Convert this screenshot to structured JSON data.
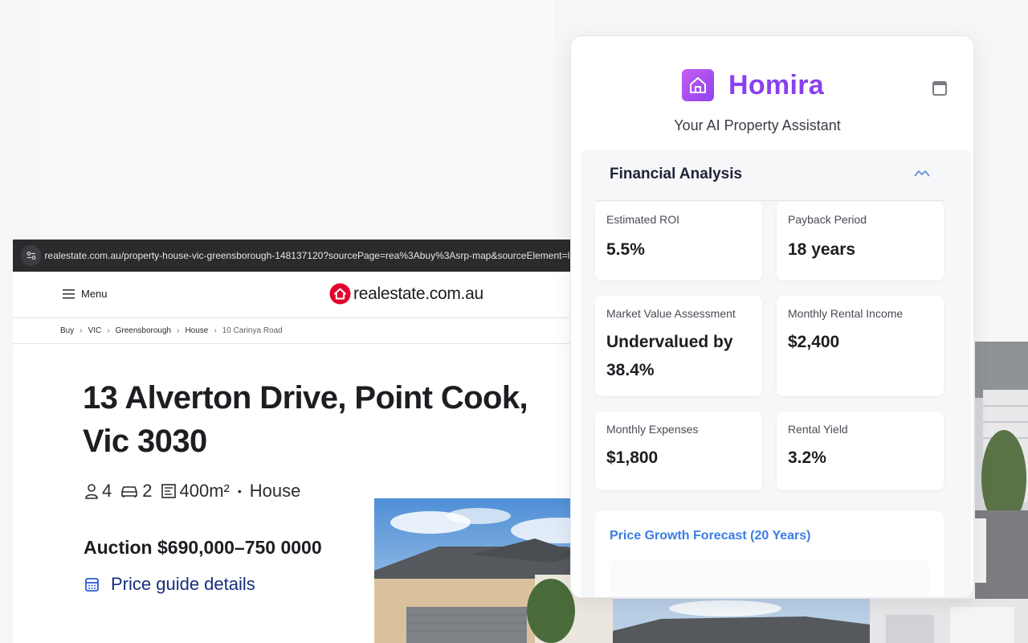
{
  "browser": {
    "url": "realestate.com.au/property-house-vic-greensborough-148137120?sourcePage=rea%3Abuy%3Asrp-map&sourceElement=listin"
  },
  "site": {
    "menu_label": "Menu",
    "logo_text": "realestate.com.au",
    "brand_color": "#e4002b"
  },
  "breadcrumb": {
    "items": [
      "Buy",
      "VIC",
      "Greensborough",
      "House"
    ],
    "current": "10 Carinya Road"
  },
  "listing": {
    "address_line1": "13 Alverton Drive, Point Cook,",
    "address_line2": "Vic 3030",
    "bedrooms": "4",
    "bathrooms": "2",
    "land_size": "400m²",
    "separator": "•",
    "property_type": "House",
    "price": "Auction $690,000–750 0000",
    "price_guide_label": "Price guide details"
  },
  "extension": {
    "brand_name": "Homira",
    "tagline": "Your AI Property Assistant",
    "accent_color": "#8a3ff0",
    "financial": {
      "title": "Financial Analysis",
      "cards": [
        {
          "label": "Estimated ROI",
          "value": "5.5%"
        },
        {
          "label": "Payback Period",
          "value": "18 years"
        },
        {
          "label": "Market Value Assessment",
          "value": "Undervalued by 38.4%"
        },
        {
          "label": "Monthly Rental Income",
          "value": "$2,400"
        },
        {
          "label": "Monthly Expenses",
          "value": "$1,800"
        },
        {
          "label": "Rental Yield",
          "value": "3.2%"
        }
      ],
      "forecast_title": "Price Growth Forecast (20 Years)"
    }
  }
}
